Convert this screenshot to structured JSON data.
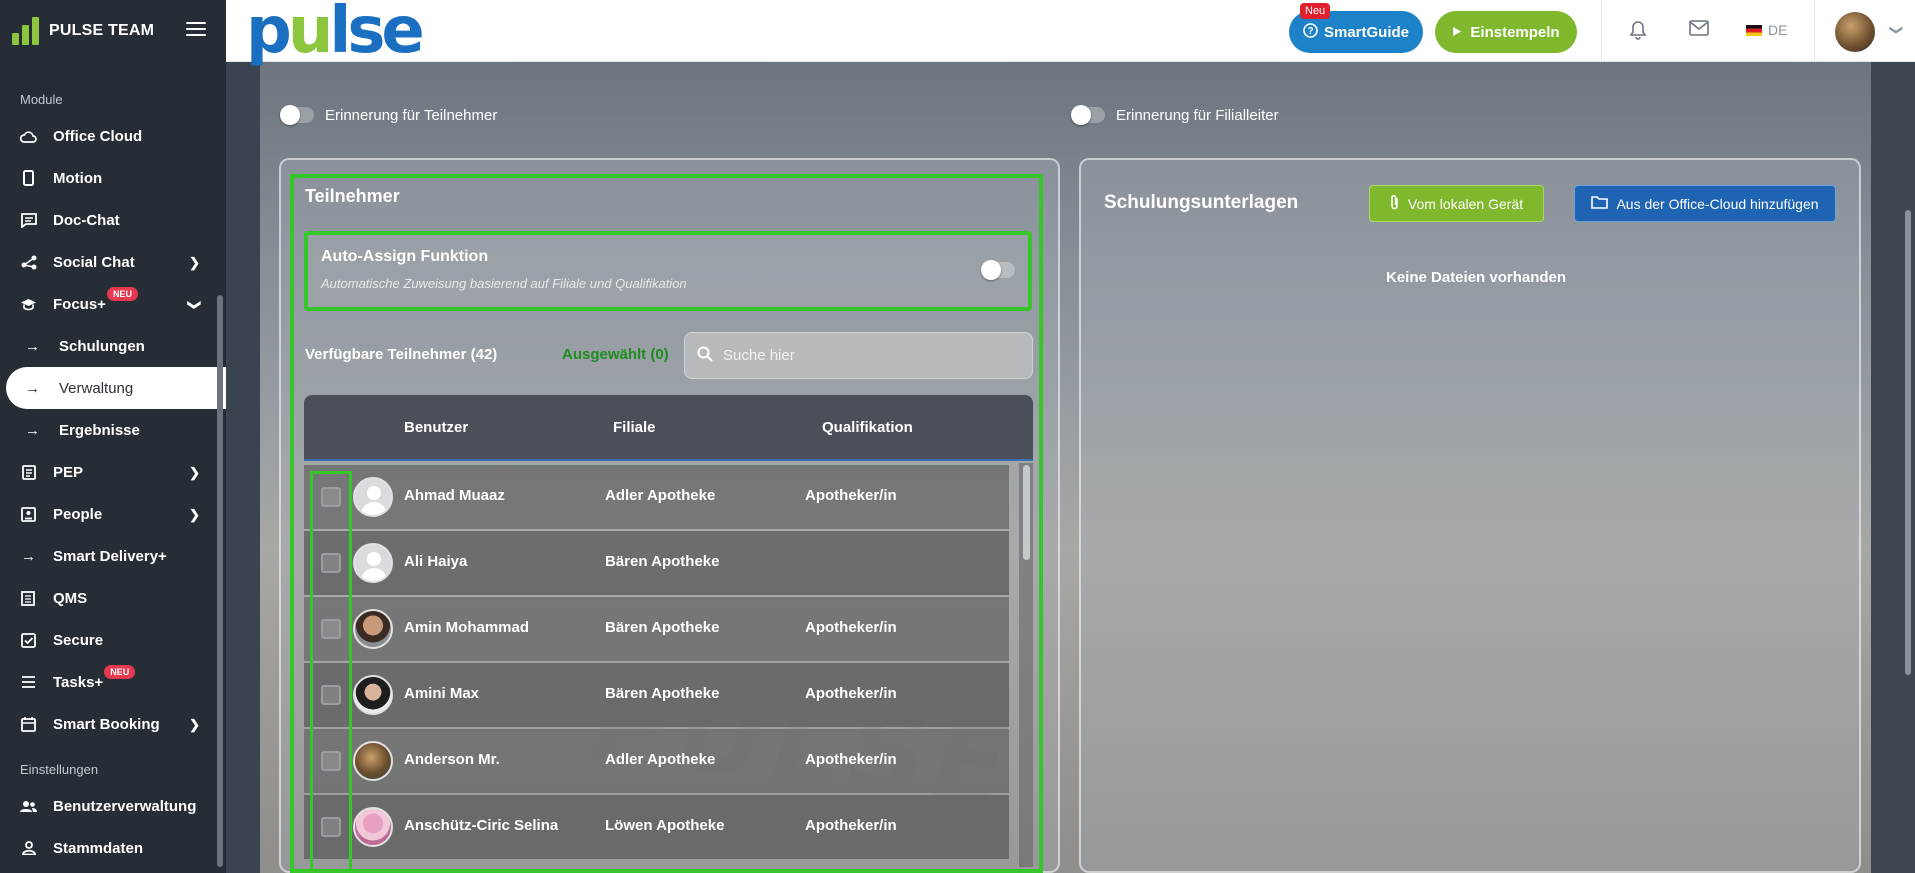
{
  "sidebar": {
    "title": "PULSE TEAM",
    "section_modules": "Module",
    "section_settings": "Einstellungen",
    "items": [
      {
        "label": "Office Cloud",
        "icon": "cloud-icon"
      },
      {
        "label": "Motion",
        "icon": "phone-icon"
      },
      {
        "label": "Doc-Chat",
        "icon": "chat-icon"
      },
      {
        "label": "Social Chat",
        "icon": "share-icon"
      },
      {
        "label": "Focus+",
        "icon": "graduation-icon",
        "badge": "NEU"
      },
      {
        "label": "Schulungen",
        "icon": "arrow-right-icon"
      },
      {
        "label": "Verwaltung",
        "icon": "arrow-right-icon"
      },
      {
        "label": "Ergebnisse",
        "icon": "arrow-right-icon"
      },
      {
        "label": "PEP",
        "icon": "clipboard-icon"
      },
      {
        "label": "People",
        "icon": "contact-card-icon"
      },
      {
        "label": "Smart Delivery+",
        "icon": "arrow-right-icon"
      },
      {
        "label": "QMS",
        "icon": "document-icon"
      },
      {
        "label": "Secure",
        "icon": "checkbox-icon"
      },
      {
        "label": "Tasks+",
        "icon": "list-icon",
        "badge": "NEU"
      },
      {
        "label": "Smart Booking",
        "icon": "calendar-icon"
      },
      {
        "label": "Benutzerverwaltung",
        "icon": "users-icon"
      },
      {
        "label": "Stammdaten",
        "icon": "user-icon"
      }
    ]
  },
  "topbar": {
    "brand": "pulse",
    "smartguide_label": "SmartGuide",
    "smartguide_tag": "Neu",
    "clockin_label": "Einstempeln",
    "language": "DE"
  },
  "reminders": {
    "participants_label": "Erinnerung für Teilnehmer",
    "branch_manager_label": "Erinnerung für Filialleiter"
  },
  "participants": {
    "heading": "Teilnehmer",
    "auto_assign_title": "Auto-Assign Funktion",
    "auto_assign_subtitle": "Automatische Zuweisung basierend auf Filiale und Qualifikation",
    "available_label": "Verfügbare Teilnehmer (42)",
    "selected_label": "Ausgewählt (0)",
    "search_placeholder": "Suche hier",
    "columns": [
      "Benutzer",
      "Filiale",
      "Qualifikation"
    ],
    "rows": [
      {
        "name": "Ahmad Muaaz",
        "branch": "Adler Apotheke",
        "qualification": "Apotheker/in"
      },
      {
        "name": "Ali Haiya",
        "branch": "Bären Apotheke",
        "qualification": ""
      },
      {
        "name": "Amin Mohammad",
        "branch": "Bären Apotheke",
        "qualification": "Apotheker/in"
      },
      {
        "name": "Amini Max",
        "branch": "Bären Apotheke",
        "qualification": "Apotheker/in"
      },
      {
        "name": "Anderson Mr.",
        "branch": "Adler Apotheke",
        "qualification": "Apotheker/in"
      },
      {
        "name": "Anschütz-Ciric Selina",
        "branch": "Löwen Apotheke",
        "qualification": "Apotheker/in"
      }
    ]
  },
  "materials": {
    "heading": "Schulungsunterlagen",
    "local_button": "Vom lokalen Gerät",
    "cloud_button": "Aus der Office-Cloud hinzufügen",
    "empty_text": "Keine Dateien vorhanden"
  },
  "colors": {
    "sidebar_bg": "#272d35",
    "brand_blue": "#1a6fc0",
    "brand_green": "#8cc63f",
    "highlight_green": "#35c729",
    "smartguide_blue": "#1e82c8",
    "cloud_button_blue": "#1f64b3"
  }
}
